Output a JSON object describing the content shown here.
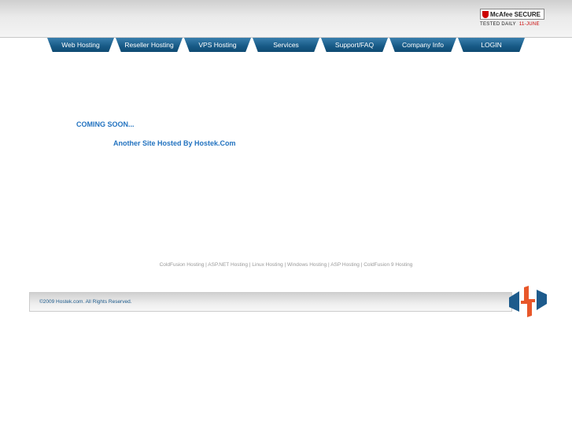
{
  "badge": {
    "brand": "McAfee SECURE",
    "tested": "TESTED DAILY",
    "date": "11-JUNE"
  },
  "nav": [
    "Web Hosting",
    "Reseller Hosting",
    "VPS Hosting",
    "Services",
    "Support/FAQ",
    "Company Info",
    "LOGIN"
  ],
  "main": {
    "coming_soon": "COMING SOON...",
    "hosted_by": "Another Site Hosted By Hostek.Com"
  },
  "links": [
    "ColdFusion Hosting",
    "ASP.NET Hosting",
    "Linux Hosting",
    "Windows Hosting",
    "ASP Hosting",
    "ColdFusion 9 Hosting"
  ],
  "footer": {
    "copyright": "©2009 Hostek.com. All Rights Reserved."
  },
  "colors": {
    "nav": "#175a86",
    "text_blue": "#2373c0",
    "logo_orange": "#e8572a",
    "logo_blue": "#1d5b8c"
  }
}
